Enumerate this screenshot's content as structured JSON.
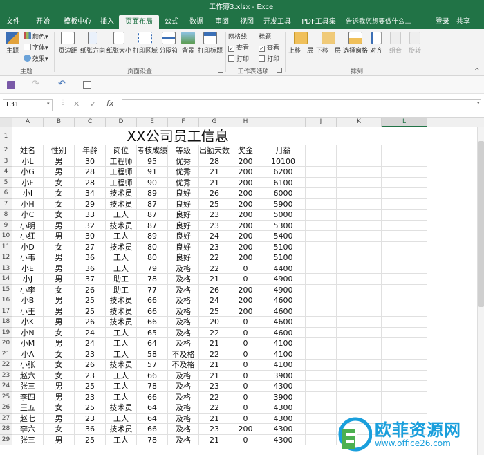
{
  "window": {
    "title": "工作簿3.xlsx - Excel"
  },
  "tabs": [
    "文件",
    "开始",
    "模板中心",
    "插入",
    "页面布局",
    "公式",
    "数据",
    "审阅",
    "视图",
    "开发工具",
    "PDF工具集"
  ],
  "active_tab": "页面布局",
  "tell_me": "告诉我您想要做什么...",
  "account": {
    "login": "登录",
    "share": "共享"
  },
  "ribbon": {
    "theme": {
      "main": "主题",
      "colors": "颜色▾",
      "fonts": "字体▾",
      "effects": "效果▾",
      "group": "主题"
    },
    "page_setup": {
      "margins": "页边距",
      "orientation": "纸张方向",
      "size": "纸张大小",
      "print_area": "打印区域",
      "breaks": "分隔符",
      "background": "背景",
      "print_titles": "打印标题",
      "group": "页面设置"
    },
    "sheet_options": {
      "gridlines": "网格线",
      "headings": "标题",
      "view": "查看",
      "print": "打印",
      "group": "工作表选项"
    },
    "arrange": {
      "bring_forward": "上移一层",
      "send_backward": "下移一层",
      "selection_pane": "选择窗格",
      "align": "对齐",
      "group_btn": "组合",
      "rotate": "旋转",
      "group": "排列"
    }
  },
  "name_box": "L31",
  "formula_icons": {
    "cancel": "✕",
    "enter": "✓",
    "fx": "fx"
  },
  "columns": [
    "A",
    "B",
    "C",
    "D",
    "E",
    "F",
    "G",
    "H",
    "I",
    "J",
    "K",
    "L"
  ],
  "selected_column": "L",
  "sheet_title": "XX公司员工信息",
  "headers": [
    "姓名",
    "性别",
    "年龄",
    "岗位",
    "考核成绩",
    "等级",
    "出勤天数",
    "奖金",
    "月薪"
  ],
  "rows": [
    [
      "小L",
      "男",
      "30",
      "工程师",
      "95",
      "优秀",
      "28",
      "200",
      "10100"
    ],
    [
      "小G",
      "男",
      "28",
      "工程师",
      "91",
      "优秀",
      "21",
      "200",
      "6200"
    ],
    [
      "小F",
      "女",
      "28",
      "工程师",
      "90",
      "优秀",
      "21",
      "200",
      "6100"
    ],
    [
      "小I",
      "女",
      "34",
      "技术员",
      "89",
      "良好",
      "26",
      "200",
      "6000"
    ],
    [
      "小H",
      "女",
      "29",
      "技术员",
      "87",
      "良好",
      "25",
      "200",
      "5900"
    ],
    [
      "小C",
      "女",
      "33",
      "工人",
      "87",
      "良好",
      "23",
      "200",
      "5000"
    ],
    [
      "小明",
      "男",
      "32",
      "技术员",
      "87",
      "良好",
      "23",
      "200",
      "5300"
    ],
    [
      "小红",
      "男",
      "30",
      "工人",
      "89",
      "良好",
      "24",
      "200",
      "5400"
    ],
    [
      "小D",
      "女",
      "27",
      "技术员",
      "80",
      "良好",
      "23",
      "200",
      "5100"
    ],
    [
      "小韦",
      "男",
      "36",
      "工人",
      "80",
      "良好",
      "22",
      "200",
      "5100"
    ],
    [
      "小E",
      "男",
      "36",
      "工人",
      "79",
      "及格",
      "22",
      "0",
      "4400"
    ],
    [
      "小J",
      "男",
      "37",
      "助工",
      "78",
      "及格",
      "21",
      "0",
      "4900"
    ],
    [
      "小李",
      "女",
      "26",
      "助工",
      "77",
      "及格",
      "26",
      "200",
      "4900"
    ],
    [
      "小B",
      "男",
      "25",
      "技术员",
      "66",
      "及格",
      "24",
      "200",
      "4600"
    ],
    [
      "小王",
      "男",
      "25",
      "技术员",
      "66",
      "及格",
      "25",
      "200",
      "4600"
    ],
    [
      "小K",
      "男",
      "26",
      "技术员",
      "66",
      "及格",
      "20",
      "0",
      "4600"
    ],
    [
      "小N",
      "女",
      "24",
      "工人",
      "65",
      "及格",
      "22",
      "0",
      "4600"
    ],
    [
      "小M",
      "男",
      "24",
      "工人",
      "64",
      "及格",
      "21",
      "0",
      "4100"
    ],
    [
      "小A",
      "女",
      "23",
      "工人",
      "58",
      "不及格",
      "22",
      "0",
      "4100"
    ],
    [
      "小张",
      "女",
      "26",
      "技术员",
      "57",
      "不及格",
      "21",
      "0",
      "4100"
    ],
    [
      "赵六",
      "女",
      "23",
      "工人",
      "66",
      "及格",
      "21",
      "0",
      "3900"
    ],
    [
      "张三",
      "男",
      "25",
      "工人",
      "78",
      "及格",
      "23",
      "0",
      "4300"
    ],
    [
      "李四",
      "男",
      "23",
      "工人",
      "66",
      "及格",
      "22",
      "0",
      "3900"
    ],
    [
      "王五",
      "女",
      "25",
      "技术员",
      "64",
      "及格",
      "22",
      "0",
      "4300"
    ],
    [
      "赵七",
      "男",
      "23",
      "工人",
      "64",
      "及格",
      "21",
      "0",
      "4300"
    ],
    [
      "李六",
      "女",
      "36",
      "技术员",
      "66",
      "及格",
      "23",
      "200",
      "4300"
    ],
    [
      "张三",
      "男",
      "25",
      "工人",
      "78",
      "及格",
      "21",
      "0",
      "4300"
    ]
  ],
  "watermark": {
    "text": "欧菲资源网",
    "url": "www.office26.com"
  },
  "colors": {
    "brand": "#217346",
    "watermark": "#1a9fdc"
  }
}
